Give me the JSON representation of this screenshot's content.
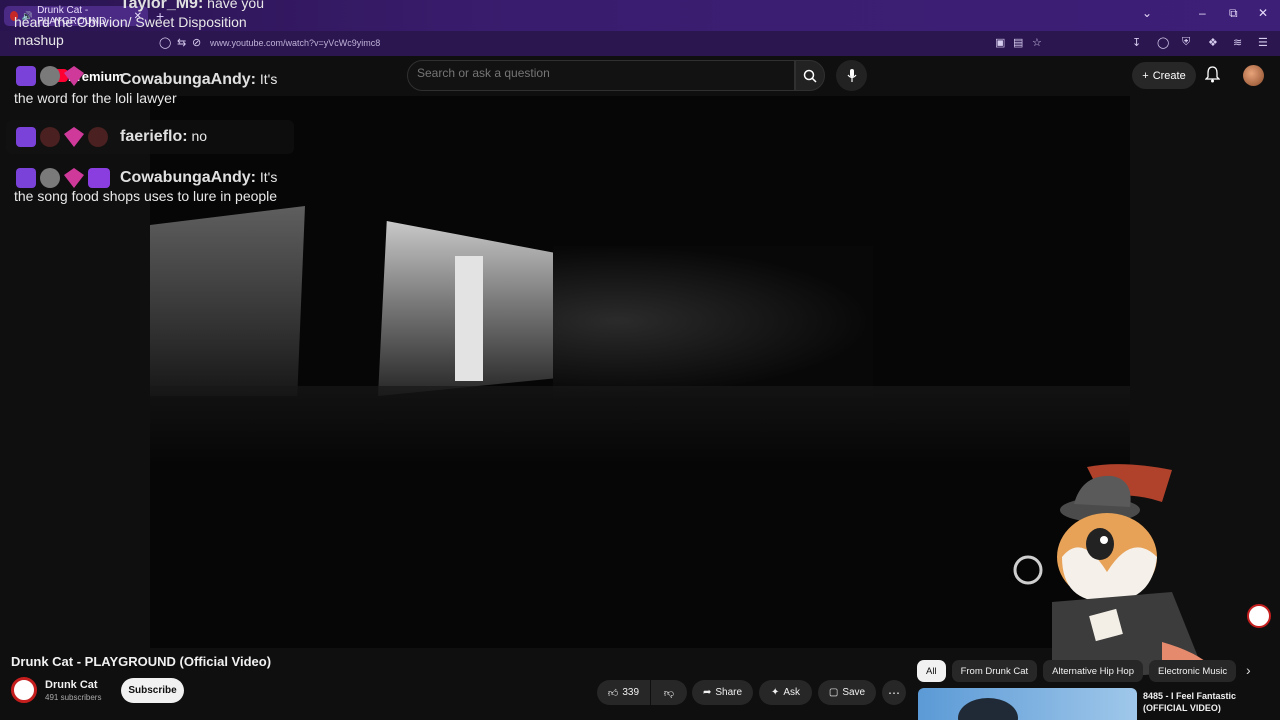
{
  "browser": {
    "tab_title": "Drunk Cat - PLAYGROUND",
    "url": "www.youtube.com/watch?v=yVcWc9yimc8"
  },
  "header": {
    "premium_label": "Premium",
    "search_placeholder": "Search or ask a question",
    "create_label": "Create"
  },
  "chat": {
    "messages": [
      {
        "name": "Taylor_M9:",
        "text": "have you heard the Oblivion/ Sweet Disposition mashup"
      },
      {
        "name": "CowabungaAndy:",
        "text": "It's the word for the loli lawyer"
      },
      {
        "name": "faerieflo:",
        "text": "no"
      },
      {
        "name": "CowabungaAndy:",
        "text": "It's the song food shops uses to lure in people"
      }
    ]
  },
  "video": {
    "title": "Drunk Cat - PLAYGROUND (Official Video)",
    "channel_name": "Drunk Cat",
    "subscribers": "491 subscribers",
    "subscribe_label": "Subscribe",
    "like_count": "339",
    "share_label": "Share",
    "ask_label": "Ask",
    "save_label": "Save"
  },
  "sidebar": {
    "chips": [
      "All",
      "From Drunk Cat",
      "Alternative Hip Hop",
      "Electronic Music"
    ],
    "recommended": [
      {
        "title": "8485 - I Feel Fantastic (OFFICIAL VIDEO)"
      }
    ]
  },
  "colors": {
    "browser_accent": "#3d1f78",
    "youtube_red": "#ff0033",
    "background": "#0f0f0f"
  }
}
